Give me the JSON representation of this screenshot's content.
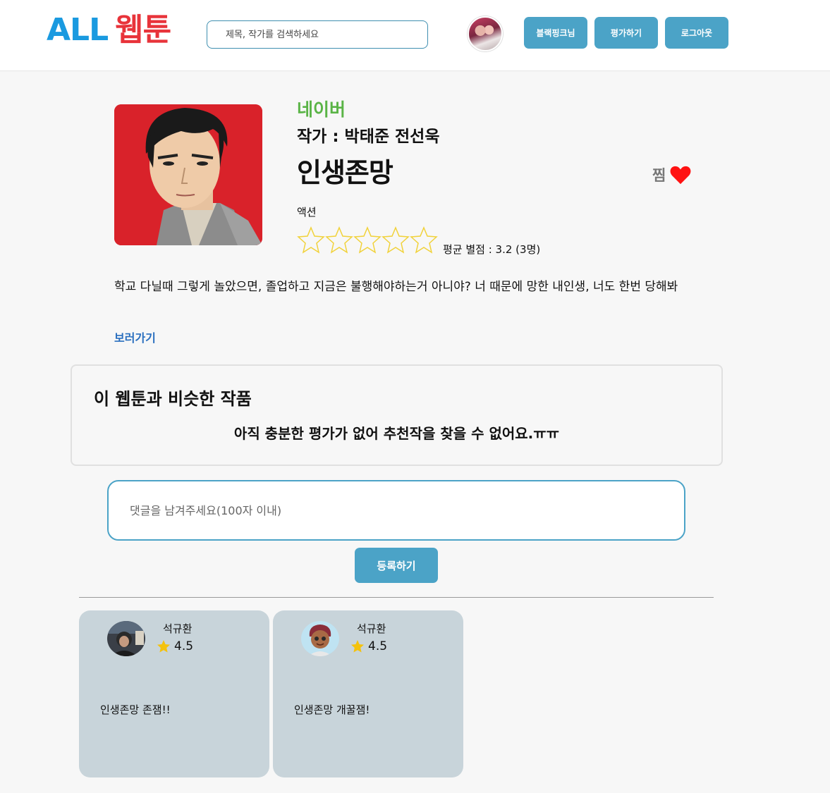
{
  "header": {
    "logo_all": "ALL",
    "logo_webtoon": "웹툰",
    "search_placeholder": "제목, 작가를 검색하세요",
    "user_button": "블랙핑크님",
    "rate_button": "평가하기",
    "logout_button": "로그아웃"
  },
  "webtoon": {
    "platform": "네이버",
    "author": "작가 : 박태준 전선욱",
    "title": "인생존망",
    "favorite_label": "찜",
    "genre": "액션",
    "avg_rating": "평균 별점 : 3.2 (3명)",
    "rating_stars_filled": 0,
    "rating_stars_total": 5,
    "description": "학교 다닐때 그렇게 놀았으면, 졸업하고 지금은 불행해야하는거 아니야? 너 때문에 망한 내인생, 너도 한번 당해봐",
    "view_link": "보러가기"
  },
  "similar": {
    "heading": "이 웹툰과 비슷한 작품",
    "empty_message": "아직 충분한 평가가 없어 추천작을 찾을 수 없어요.ㅠㅠ"
  },
  "comment_form": {
    "placeholder": "댓글을 남겨주세요(100자 이내)",
    "submit_label": "등록하기"
  },
  "comments": [
    {
      "name": "석규환",
      "score": "4.5",
      "text": "인생존망 존잼!!"
    },
    {
      "name": "석규환",
      "score": "4.5",
      "text": "인생존망 개꿀잼!"
    }
  ],
  "colors": {
    "accent": "#4ba3c7",
    "platform_green": "#5ab446",
    "logo_blue": "#1a9ae0",
    "logo_red": "#e8333a",
    "card_bg": "#c8d4da"
  }
}
